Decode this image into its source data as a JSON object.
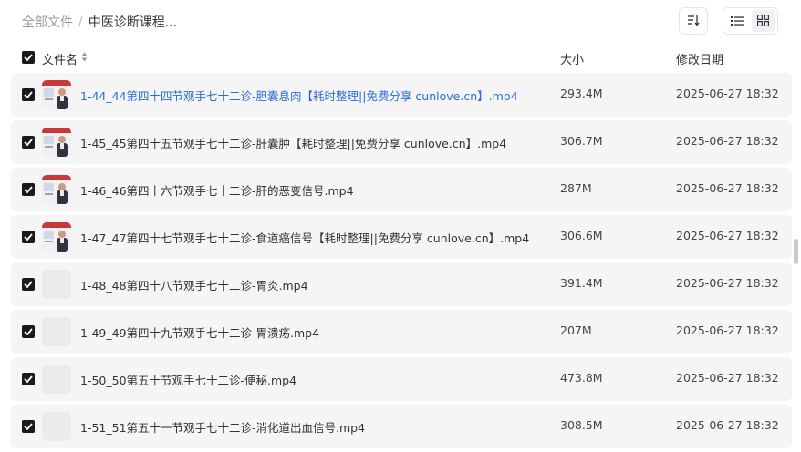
{
  "breadcrumb": {
    "root": "全部文件",
    "separator": "/",
    "current": "中医诊断课程..."
  },
  "toolbar": {
    "sort_icon": "sort-icon",
    "list_icon": "list-view-icon",
    "grid_icon": "grid-view-icon",
    "active_view": "list"
  },
  "header": {
    "name": "文件名",
    "size": "大小",
    "modified": "修改日期"
  },
  "files": [
    {
      "name": "1-44_44第四十四节观手七十二诊-胆囊息肉【耗时整理||免费分享 cunlove.cn】.mp4",
      "size": "293.4M",
      "date": "2025-06-27 18:32",
      "thumb": true,
      "highlight": true
    },
    {
      "name": "1-45_45第四十五节观手七十二诊-肝囊肿【耗时整理||免费分享 cunlove.cn】.mp4",
      "size": "306.7M",
      "date": "2025-06-27 18:32",
      "thumb": true,
      "highlight": false
    },
    {
      "name": "1-46_46第四十六节观手七十二诊-肝的恶变信号.mp4",
      "size": "287M",
      "date": "2025-06-27 18:32",
      "thumb": true,
      "highlight": false
    },
    {
      "name": "1-47_47第四十七节观手七十二诊-食道癌信号【耗时整理||免费分享 cunlove.cn】.mp4",
      "size": "306.6M",
      "date": "2025-06-27 18:32",
      "thumb": true,
      "highlight": false
    },
    {
      "name": "1-48_48第四十八节观手七十二诊-胃炎.mp4",
      "size": "391.4M",
      "date": "2025-06-27 18:32",
      "thumb": false,
      "highlight": false
    },
    {
      "name": "1-49_49第四十九节观手七十二诊-胃溃疡.mp4",
      "size": "207M",
      "date": "2025-06-27 18:32",
      "thumb": false,
      "highlight": false
    },
    {
      "name": "1-50_50第五十节观手七十二诊-便秘.mp4",
      "size": "473.8M",
      "date": "2025-06-27 18:32",
      "thumb": false,
      "highlight": false
    },
    {
      "name": "1-51_51第五十一节观手七十二诊-消化道出血信号.mp4",
      "size": "308.5M",
      "date": "2025-06-27 18:32",
      "thumb": false,
      "highlight": false
    }
  ]
}
